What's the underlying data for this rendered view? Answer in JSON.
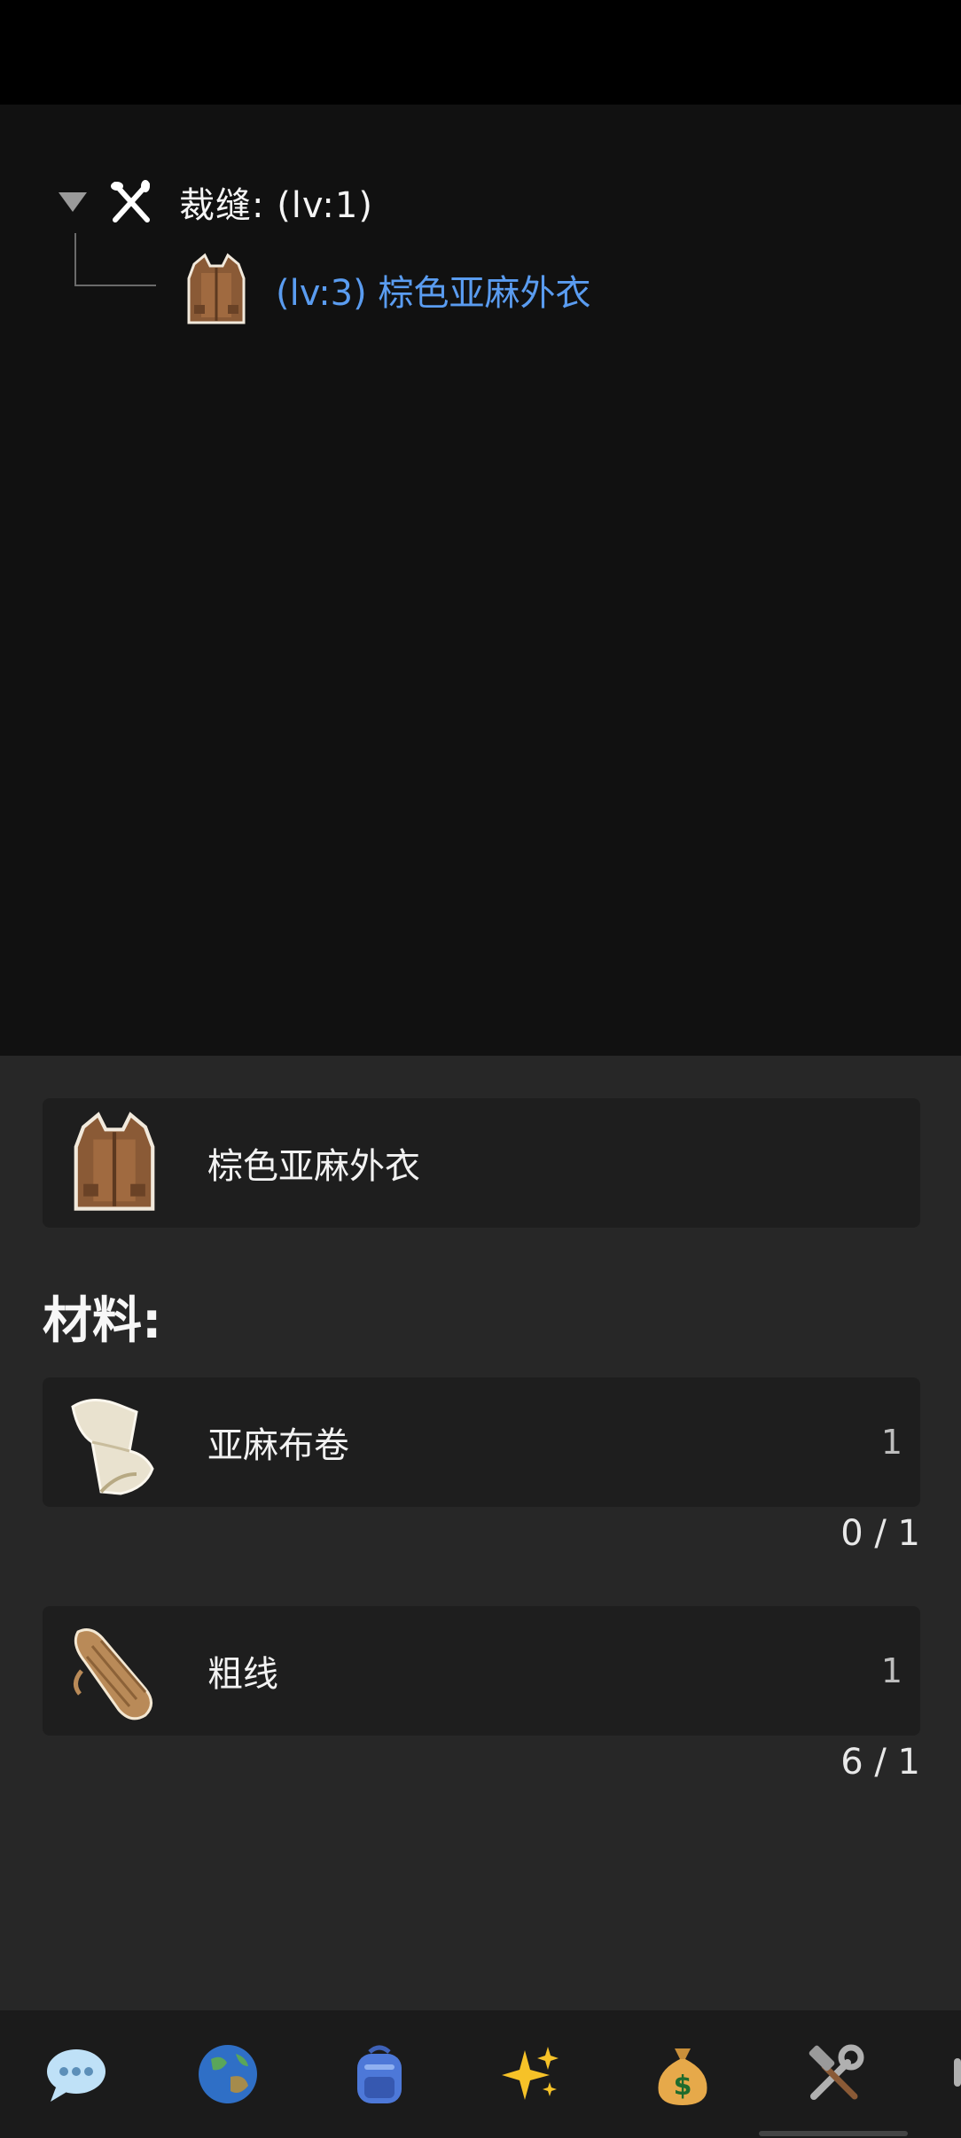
{
  "tree": {
    "root": {
      "label": "裁缝:  (lv:1)",
      "icon": "crossed-tools-icon",
      "expanded": true
    },
    "children": [
      {
        "label": "(lv:3) 棕色亚麻外衣",
        "icon": "brown-linen-coat-icon",
        "color": "#5a9cf0"
      }
    ]
  },
  "detail": {
    "item": {
      "label": "棕色亚麻外衣",
      "icon": "brown-linen-coat-icon"
    },
    "materials_title": "材料:",
    "materials": [
      {
        "label": "亚麻布卷",
        "qty": "1",
        "progress": "0 / 1",
        "icon": "linen-roll-icon"
      },
      {
        "label": "粗线",
        "qty": "1",
        "progress": "6 / 1",
        "icon": "coarse-thread-icon"
      }
    ]
  },
  "nav": {
    "items": [
      {
        "icon": "chat-bubble-icon"
      },
      {
        "icon": "globe-icon"
      },
      {
        "icon": "backpack-icon"
      },
      {
        "icon": "sparkles-icon"
      },
      {
        "icon": "money-bag-icon"
      },
      {
        "icon": "hammer-wrench-icon"
      }
    ]
  },
  "colors": {
    "accent_link": "#5a9cf0",
    "panel_top": "#111111",
    "panel_bottom": "#272727",
    "card": "#1e1e1e"
  }
}
